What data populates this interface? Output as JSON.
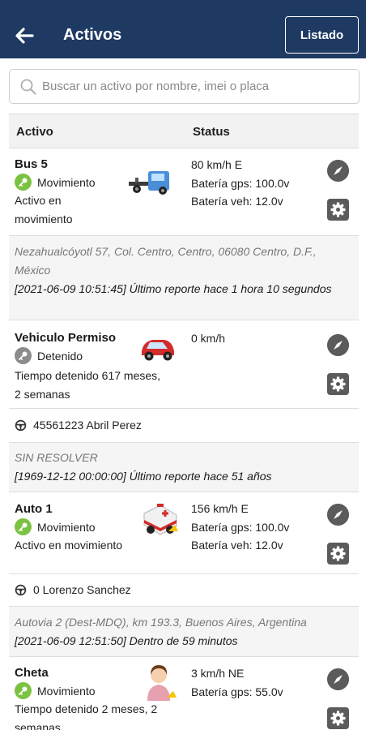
{
  "header": {
    "title": "Activos",
    "list_button": "Listado"
  },
  "search": {
    "placeholder": "Buscar un activo por nombre, imei o placa"
  },
  "table": {
    "col_asset": "Activo",
    "col_status": "Status"
  },
  "assets": [
    {
      "name": "Bus 5",
      "state": "Movimiento",
      "state_color": "#7cc242",
      "desc_line1": "Activo en",
      "desc_line2": "movimiento",
      "vehicle_icon": "tow-truck-icon",
      "speed": "80 km/h E",
      "gps_battery": "Batería gps: 100.0v",
      "veh_battery": "Batería veh: 12.0v",
      "address": "Nezahualcóyotl 57, Col. Centro, Centro, 06080 Centro, D.F., México",
      "report": "[2021-06-09 10:51:45] Último reporte hace 1 hora 10 segundos"
    },
    {
      "name": "Vehiculo Permiso",
      "state": "Detenido",
      "state_color": "#8c8c8c",
      "desc_line1": "Tiempo detenido 617 meses,",
      "desc_line2": "2 semanas",
      "vehicle_icon": "red-car-icon",
      "speed": "0 km/h",
      "driver": "45561223 Abril Perez",
      "address": "SIN RESOLVER",
      "report": "[1969-12-12 00:00:00] Último reporte hace 51 años"
    },
    {
      "name": "Auto 1",
      "state": "Movimiento",
      "state_color": "#7cc242",
      "desc_line1": "Activo en movimiento",
      "vehicle_icon": "ambulance-icon",
      "speed": "156 km/h E",
      "gps_battery": "Batería gps: 100.0v",
      "veh_battery": "Batería veh: 12.0v",
      "driver": "0 Lorenzo Sanchez",
      "address": "Autovia 2 (Dest-MDQ), km 193.3, Buenos Aires, Argentina",
      "report": "[2021-06-09 12:51:50] Dentro de 59 minutos"
    },
    {
      "name": "Cheta",
      "state": "Movimiento",
      "state_color": "#7cc242",
      "desc_line1": "Tiempo detenido 2 meses, 2",
      "desc_line2": "semanas",
      "vehicle_icon": "person-icon",
      "speed": "3 km/h NE",
      "gps_battery": "Batería gps: 55.0v"
    }
  ]
}
